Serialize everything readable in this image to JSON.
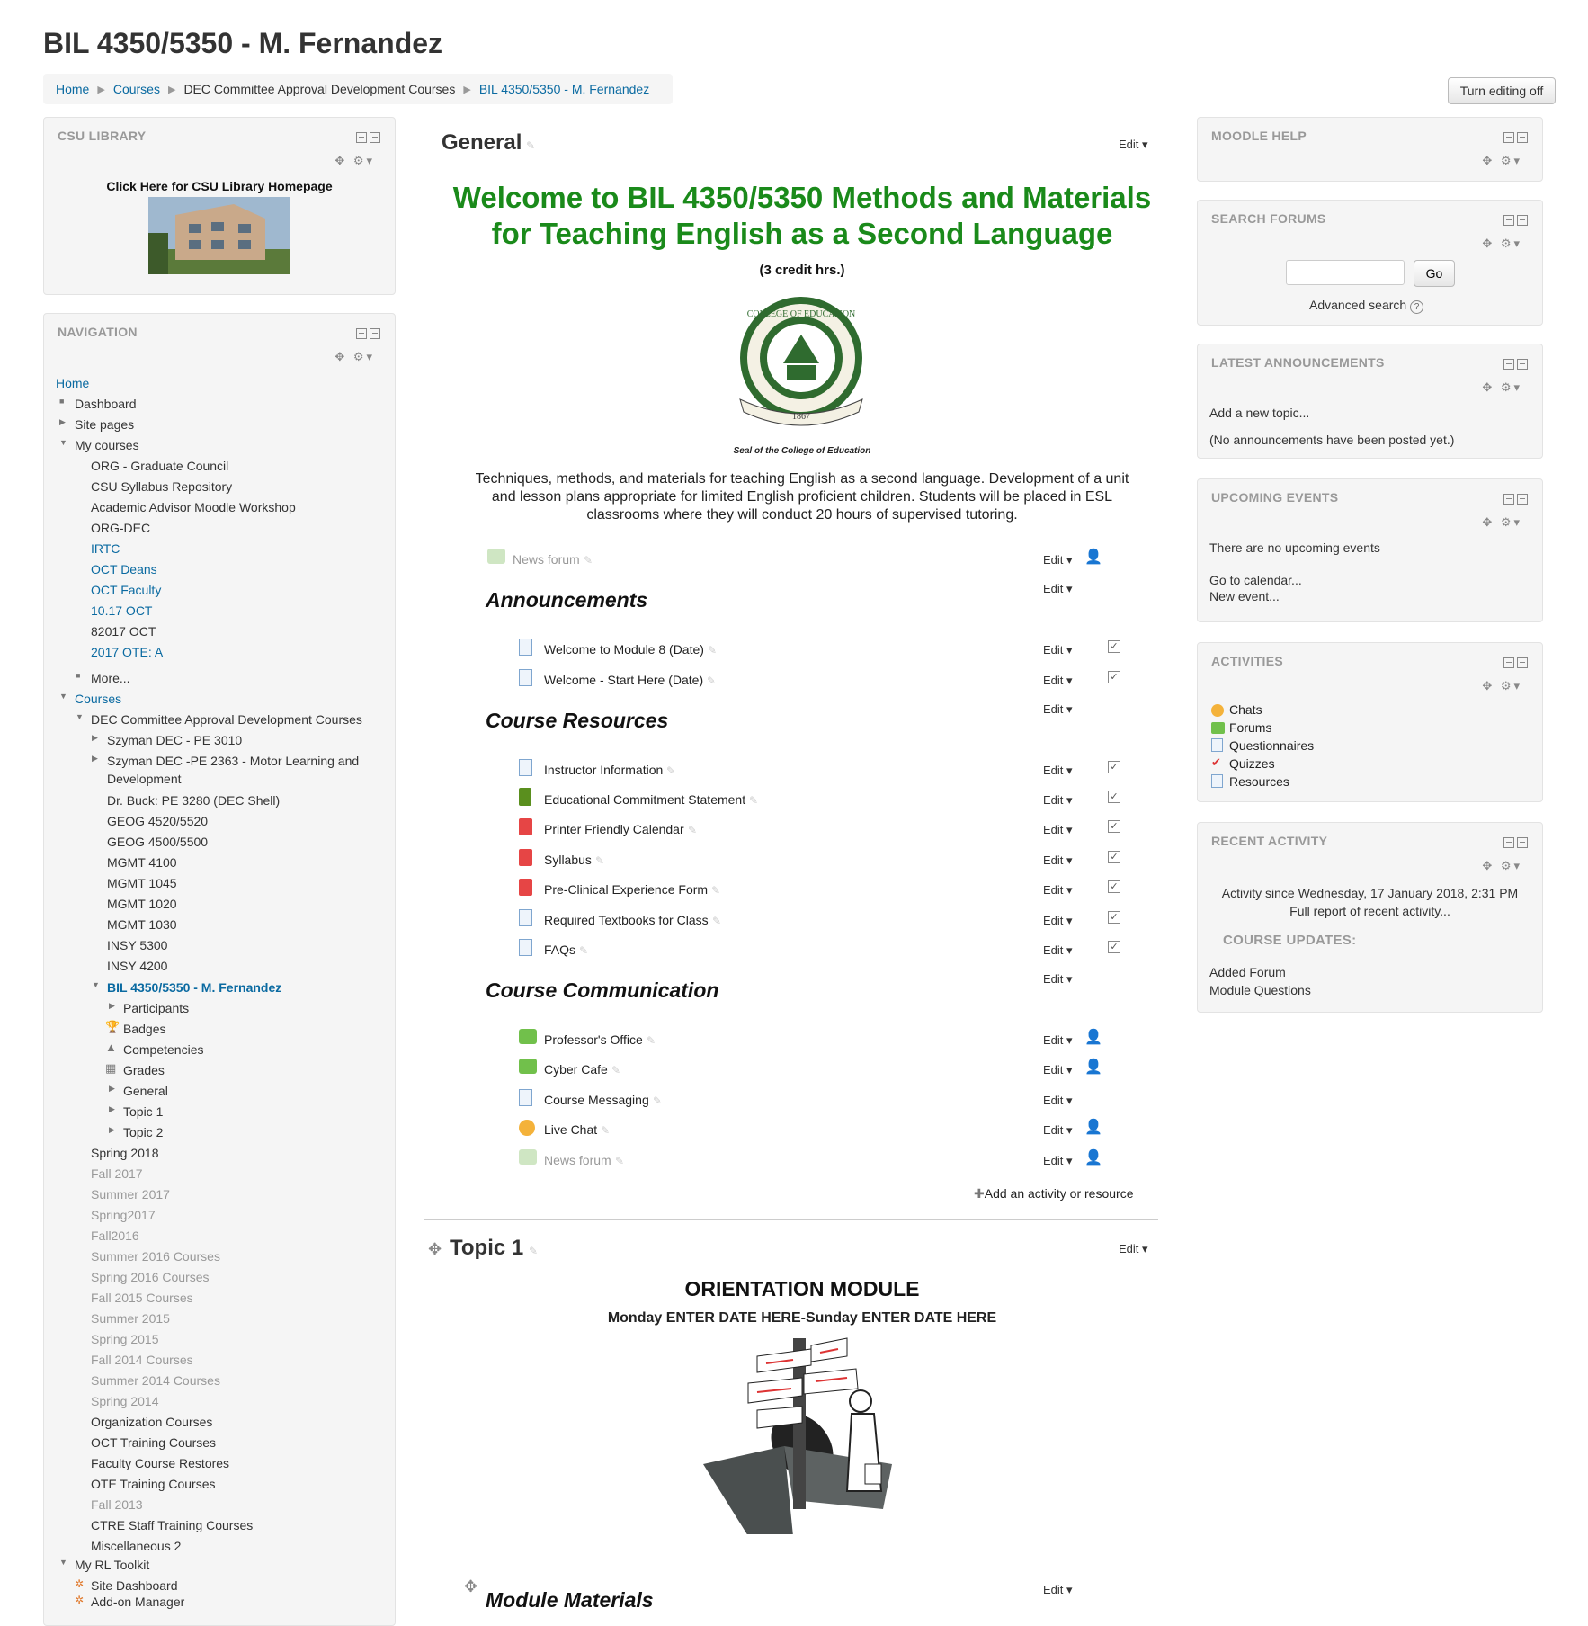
{
  "page_title": "BIL 4350/5350 - M. Fernandez",
  "breadcrumb": [
    "Home",
    "Courses",
    "DEC Committee Approval Development Courses",
    "BIL 4350/5350 - M. Fernandez"
  ],
  "turn_editing_label": "Turn editing off",
  "csu_library": {
    "title": "CSU LIBRARY",
    "link_text": "Click Here for CSU Library Homepage"
  },
  "navigation": {
    "title": "NAVIGATION",
    "home": "Home",
    "dashboard": "Dashboard",
    "site_pages": "Site pages",
    "my_courses": "My courses",
    "my_courses_items": [
      {
        "label": "ORG - Graduate Council",
        "style": "plain"
      },
      {
        "label": "CSU Syllabus Repository",
        "style": "plain"
      },
      {
        "label": "Academic Advisor Moodle Workshop",
        "style": "plain"
      },
      {
        "label": "ORG-DEC",
        "style": "plain"
      },
      {
        "label": "IRTC",
        "style": "link"
      },
      {
        "label": "OCT Deans",
        "style": "link"
      },
      {
        "label": "OCT Faculty",
        "style": "link"
      },
      {
        "label": "10.17 OCT",
        "style": "link"
      },
      {
        "label": "82017 OCT",
        "style": "plain"
      },
      {
        "label": "2017 OTE: A",
        "style": "link"
      }
    ],
    "more": "More...",
    "courses": "Courses",
    "dec_category": "DEC Committee Approval Development Courses",
    "dec_items": [
      "Szyman DEC - PE 3010"
    ],
    "dec_item_wrap_1": "Szyman DEC -PE 2363 - Motor Learning and",
    "dec_item_wrap_2": "Development",
    "dec_items_2": [
      "Dr. Buck: PE 3280 (DEC Shell)",
      "GEOG 4520/5520",
      "GEOG 4500/5500",
      "MGMT 4100",
      "MGMT 1045",
      "MGMT 1020",
      "MGMT 1030",
      "INSY 5300",
      "INSY 4200"
    ],
    "current_course": "BIL 4350/5350 - M. Fernandez",
    "course_children": [
      "Participants",
      "Badges",
      "Competencies",
      "Grades",
      "General",
      "Topic 1",
      "Topic 2"
    ],
    "other_categories": [
      {
        "label": "Spring 2018",
        "style": "plain"
      },
      {
        "label": "Fall 2017",
        "style": "dim"
      },
      {
        "label": "Summer 2017",
        "style": "dim"
      },
      {
        "label": "Spring2017",
        "style": "dim"
      },
      {
        "label": "Fall2016",
        "style": "dim"
      },
      {
        "label": "Summer 2016 Courses",
        "style": "dim"
      },
      {
        "label": "Spring 2016 Courses",
        "style": "dim"
      },
      {
        "label": "Fall 2015 Courses",
        "style": "dim"
      },
      {
        "label": "Summer 2015",
        "style": "dim"
      },
      {
        "label": "Spring 2015",
        "style": "dim"
      },
      {
        "label": "Fall 2014 Courses",
        "style": "dim"
      },
      {
        "label": "Summer 2014 Courses",
        "style": "dim"
      },
      {
        "label": "Spring 2014",
        "style": "dim"
      },
      {
        "label": "Organization Courses",
        "style": "plain"
      },
      {
        "label": "OCT Training Courses",
        "style": "plain"
      },
      {
        "label": "Faculty Course Restores",
        "style": "plain"
      },
      {
        "label": "OTE Training Courses",
        "style": "plain"
      },
      {
        "label": "Fall 2013",
        "style": "dim"
      },
      {
        "label": "CTRE Staff Training Courses",
        "style": "plain"
      },
      {
        "label": "Miscellaneous 2",
        "style": "plain"
      }
    ],
    "rl_toolkit": "My RL Toolkit",
    "site_dashboard": "Site Dashboard",
    "add_on_manager": "Add-on Manager"
  },
  "general": {
    "title": "General",
    "edit": "Edit",
    "welcome_line1": "Welcome to BIL 4350/5350 Methods and Materials",
    "welcome_line2": "for Teaching English as a Second Language",
    "credit": "(3 credit hrs.)",
    "seal_top": "COLLEGE OF EDUCATION",
    "seal_year": "1867",
    "seal_caption": "Seal of the College of Education",
    "desc1": "Techniques, methods, and materials for teaching English as a second language. Development of a unit",
    "desc2": "and lesson plans appropriate for limited English proficient children. Students will be placed in ESL",
    "desc3": "classrooms where they will conduct 20 hours of supervised tutoring.",
    "news_forum": "News forum",
    "announcements": "Announcements",
    "ann_items": [
      "Welcome to Module 8 (Date)",
      "Welcome - Start Here (Date)"
    ],
    "course_resources": "Course Resources",
    "res_items": [
      "Instructor Information",
      "Educational Commitment Statement",
      "Printer Friendly Calendar",
      "Syllabus",
      "Pre-Clinical Experience Form",
      "Required Textbooks for Class",
      "FAQs"
    ],
    "course_communication": "Course Communication",
    "comm_items": [
      "Professor's Office",
      "Cyber Cafe",
      "Course Messaging",
      "Live Chat",
      "News forum"
    ],
    "add_activity": "Add an activity or resource"
  },
  "topic1": {
    "title": "Topic 1",
    "edit": "Edit",
    "heading": "ORIENTATION MODULE",
    "dates": "Monday ENTER DATE HERE-Sunday ENTER DATE HERE",
    "module_materials": "Module Materials"
  },
  "moodle_help": {
    "title": "MOODLE HELP"
  },
  "search_forums": {
    "title": "SEARCH FORUMS",
    "go": "Go",
    "advanced": "Advanced search",
    "value": ""
  },
  "latest_announcements": {
    "title": "LATEST ANNOUNCEMENTS",
    "add": "Add a new topic...",
    "none": "(No announcements have been posted yet.)"
  },
  "upcoming_events": {
    "title": "UPCOMING EVENTS",
    "none": "There are no upcoming events",
    "calendar": "Go to calendar...",
    "new_event": "New event..."
  },
  "activities": {
    "title": "ACTIVITIES",
    "items": [
      "Chats",
      "Forums",
      "Questionnaires",
      "Quizzes",
      "Resources"
    ]
  },
  "recent_activity": {
    "title": "RECENT ACTIVITY",
    "since": "Activity since Wednesday, 17 January 2018, 2:31 PM",
    "full_report": "Full report of recent activity...",
    "updates_title": "COURSE UPDATES:",
    "added": "Added Forum",
    "module_q": "Module Questions"
  }
}
